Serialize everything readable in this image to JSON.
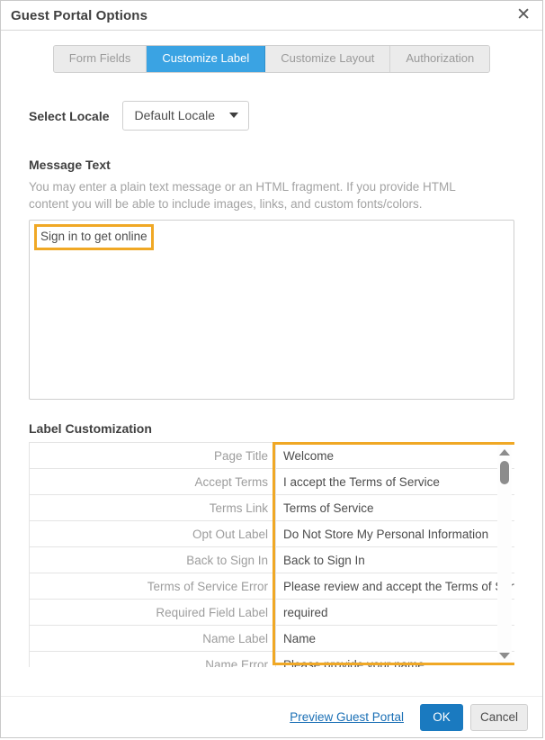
{
  "window": {
    "title": "Guest Portal Options",
    "close_icon": "close-icon",
    "close_glyph": "✕"
  },
  "tabs": [
    {
      "label": "Form Fields",
      "active": false
    },
    {
      "label": "Customize Label",
      "active": true
    },
    {
      "label": "Customize Layout",
      "active": false
    },
    {
      "label": "Authorization",
      "active": false
    }
  ],
  "locale": {
    "label": "Select Locale",
    "selected": "Default Locale",
    "caret_icon": "chevron-down-icon"
  },
  "message": {
    "title": "Message Text",
    "description": "You may enter a plain text message or an HTML fragment. If you provide HTML content you will be able to include images, links, and custom fonts/colors.",
    "value": "Sign in to get online"
  },
  "label_customization": {
    "title": "Label Customization",
    "rows": [
      {
        "key": "Page Title",
        "value": "Welcome"
      },
      {
        "key": "Accept Terms",
        "value": "I accept the Terms of Service"
      },
      {
        "key": "Terms Link",
        "value": "Terms of Service"
      },
      {
        "key": "Opt Out Label",
        "value": "Do Not Store My Personal Information"
      },
      {
        "key": "Back to Sign In",
        "value": "Back to Sign In"
      },
      {
        "key": "Terms of Service Error",
        "value": "Please review and accept the Terms of Service"
      },
      {
        "key": "Required Field Label",
        "value": "required"
      },
      {
        "key": "Name Label",
        "value": "Name"
      },
      {
        "key": "Name Error",
        "value": "Please provide your name"
      }
    ],
    "scroll": {
      "up_icon": "scroll-up-arrow-icon",
      "down_icon": "scroll-down-arrow-icon",
      "thumb": "scrollbar-thumb"
    }
  },
  "footer": {
    "preview_link": "Preview Guest Portal",
    "ok": "OK",
    "cancel": "Cancel"
  },
  "colors": {
    "active_tab": "#3aa3e3",
    "highlight": "#f0a825",
    "primary_button": "#1a7ac0",
    "link": "#1a6fb5"
  }
}
